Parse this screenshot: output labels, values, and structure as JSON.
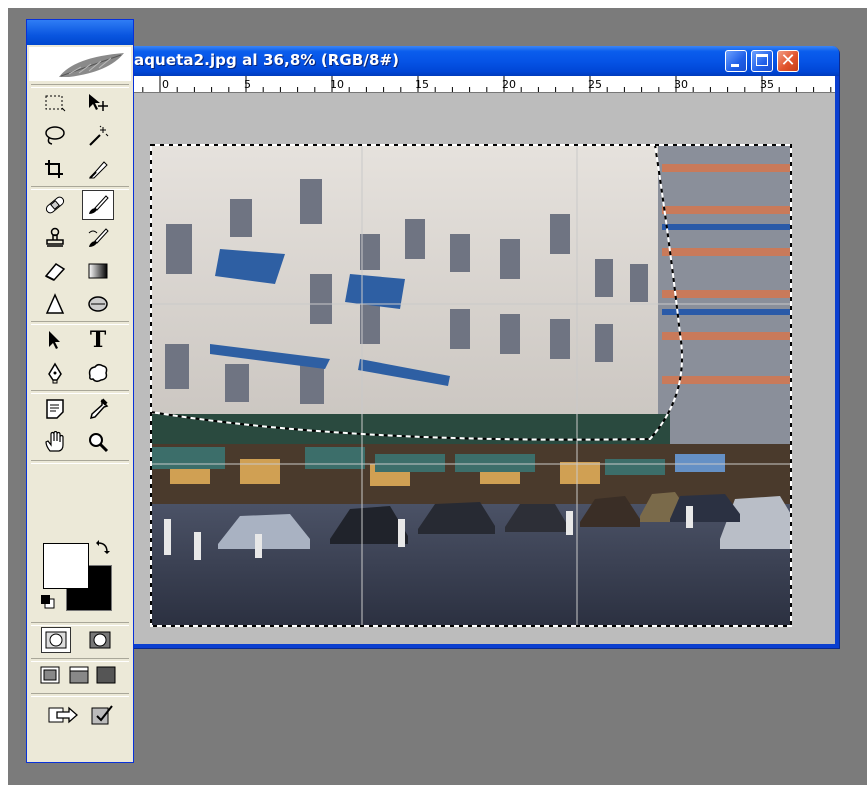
{
  "document": {
    "title": "aqueta2.jpg al 36,8% (RGB/8#)",
    "ruler_labels": [
      "0",
      "5",
      "10",
      "15",
      "20",
      "25",
      "30",
      "35"
    ]
  },
  "window_controls": {
    "minimize": "minimize-icon",
    "maximize": "maximize-icon",
    "close": "close-icon"
  },
  "toolbox": {
    "tools": [
      "rectangular-marquee-tool-icon",
      "move-tool-icon",
      "lasso-tool-icon",
      "magic-wand-tool-icon",
      "crop-tool-icon",
      "slice-tool-icon",
      "healing-brush-tool-icon",
      "brush-tool-icon",
      "clone-stamp-tool-icon",
      "history-brush-tool-icon",
      "eraser-tool-icon",
      "gradient-tool-icon",
      "blur-tool-icon",
      "dodge-tool-icon",
      "path-selection-tool-icon",
      "type-tool-icon",
      "pen-tool-icon",
      "custom-shape-tool-icon",
      "notes-tool-icon",
      "eyedropper-tool-icon",
      "hand-tool-icon",
      "zoom-tool-icon"
    ],
    "active_tool": "brush-tool-icon",
    "type_tool_glyph": "T",
    "foreground_color": "#ffffff",
    "background_color": "#000000"
  },
  "colors": {
    "titlebar_blue": "#0654e6",
    "close_red": "#e2542d",
    "workspace_gray": "#7b7b7b",
    "canvas_gray": "#bcbcbc"
  }
}
